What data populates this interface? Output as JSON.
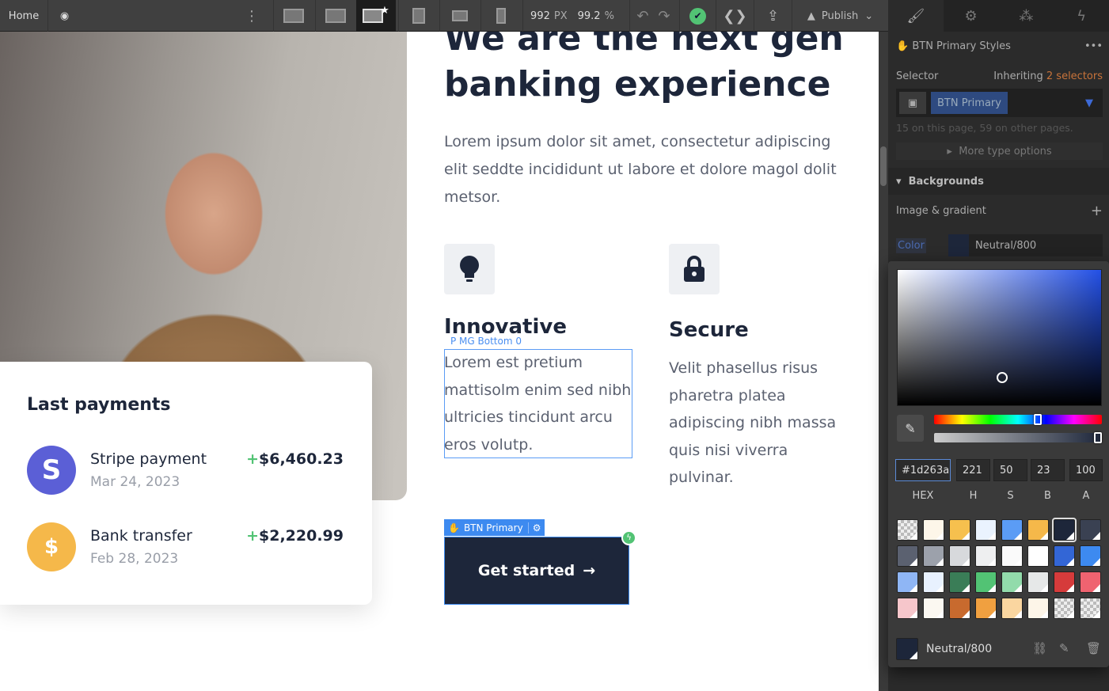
{
  "topbar": {
    "page": "Home",
    "width_value": "992",
    "width_unit": "PX",
    "zoom": "99.2",
    "zoom_unit": "%",
    "publish": "Publish"
  },
  "canvas": {
    "hero_title": "We are the next gen banking experience",
    "lead": "Lorem ipsum dolor sit amet, consectetur adipiscing elit seddte incididunt ut labore et dolore magol dolit metsor.",
    "features": [
      {
        "title": "Innovative",
        "text": "Lorem est pretium mattisolm enim sed nibh ultricies tincidunt arcu eros volutp.",
        "icon": "lightbulb-icon"
      },
      {
        "title": "Secure",
        "text": "Velit phasellus risus pharetra platea adipiscing nibh massa quis nisi viverra pulvinar.",
        "icon": "lock-icon"
      }
    ],
    "selection_label": "P  MG Bottom 0",
    "button_tag": "BTN Primary",
    "button_label": "Get started",
    "card": {
      "title": "Last payments",
      "payments": [
        {
          "name": "Stripe payment",
          "date": "Mar 24, 2023",
          "sign": "+",
          "amount": "$6,460.23",
          "avatar": "S",
          "color": "#5b5fd6"
        },
        {
          "name": "Bank transfer",
          "date": "Feb 28, 2023",
          "sign": "+",
          "amount": "$2,220.99",
          "avatar": "$",
          "color": "#f5b84a"
        }
      ]
    }
  },
  "panel": {
    "styles_title": "BTN Primary Styles",
    "selector_label": "Selector",
    "inheriting": "Inheriting",
    "inheriting_count": "2 selectors",
    "selector_chip": "BTN Primary",
    "usage": "15 on this page, 59 on other pages.",
    "more_type": "More type options",
    "section": "Backgrounds",
    "image_gradient": "Image & gradient",
    "color_label": "Color",
    "color_value": "Neutral/800"
  },
  "picker": {
    "hex": "#1d263a",
    "h": "221",
    "s": "50",
    "b": "23",
    "a": "100",
    "labels": [
      "HEX",
      "H",
      "S",
      "B",
      "A"
    ],
    "swatch_name": "Neutral/800",
    "swatches": [
      "checker",
      "#fdf6e9",
      "#f6c04e",
      "#eaf3fe",
      "#5b9cf5",
      "#f5b84a",
      "#1d263a",
      "#3a4152",
      "#5b6170",
      "#9ca1ab",
      "#d7d9dc",
      "#eeeff0",
      "#fafafa",
      "#ffffff",
      "#3366d6",
      "#3d8af0",
      "#8fb6f5",
      "#e8f1fe",
      "#3a7d57",
      "#52c374",
      "#92dbab",
      "#e6e8e8",
      "#d63b3b",
      "#ef6370",
      "#f6c6cb",
      "#fbf8f1",
      "#c86a2e",
      "#f0a040",
      "#fad6a0",
      "#fdf5e8",
      "checker",
      "checker"
    ],
    "selected_swatch": "#1d263a"
  }
}
